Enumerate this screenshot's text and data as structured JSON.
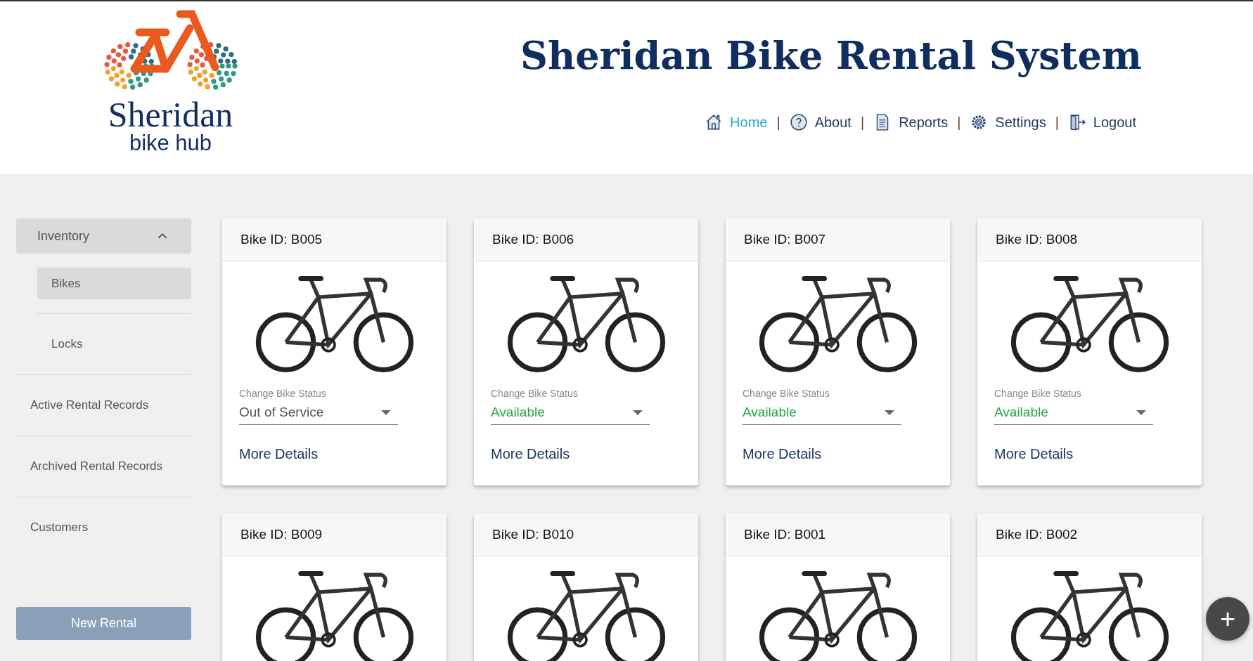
{
  "logo": {
    "name": "Sheridan",
    "subtitle": "bike hub"
  },
  "title": "Sheridan Bike Rental System",
  "nav": [
    {
      "kind": "home",
      "label": "Home",
      "selected": true
    },
    {
      "kind": "about",
      "label": "About",
      "selected": false,
      "separator": "|"
    },
    {
      "kind": "reports",
      "label": "Reports",
      "selected": false,
      "separator": "|"
    },
    {
      "kind": "settings",
      "label": "Settings",
      "selected": false,
      "separator": "|"
    },
    {
      "kind": "logout",
      "label": "Logout",
      "selected": false,
      "separator": "|"
    }
  ],
  "sidebar": {
    "items": [
      {
        "label": "Inventory",
        "expanded": true,
        "children": [
          {
            "label": "Bikes",
            "selected": true
          },
          {
            "label": "Locks",
            "selected": false
          }
        ]
      },
      {
        "label": "Active Rental Records"
      },
      {
        "label": "Archived Rental Records"
      },
      {
        "label": "Customers"
      }
    ],
    "button": "New Rental"
  },
  "cards": [
    {
      "title": "Bike ID: B005",
      "status_label": "Change Bike Status",
      "status": "Out of Service",
      "color": "#555555",
      "link": "More Details"
    },
    {
      "title": "Bike ID: B006",
      "status_label": "Change Bike Status",
      "status": "Available",
      "color": "#28a745",
      "link": "More Details"
    },
    {
      "title": "Bike ID: B007",
      "status_label": "Change Bike Status",
      "status": "Available",
      "color": "#28a745",
      "link": "More Details"
    },
    {
      "title": "Bike ID: B008",
      "status_label": "Change Bike Status",
      "status": "Available",
      "color": "#28a745",
      "link": "More Details"
    },
    {
      "title": "Bike ID: B009"
    },
    {
      "title": "Bike ID: B010"
    },
    {
      "title": "Bike ID: B001"
    },
    {
      "title": "Bike ID: B002"
    }
  ],
  "fab": "+"
}
